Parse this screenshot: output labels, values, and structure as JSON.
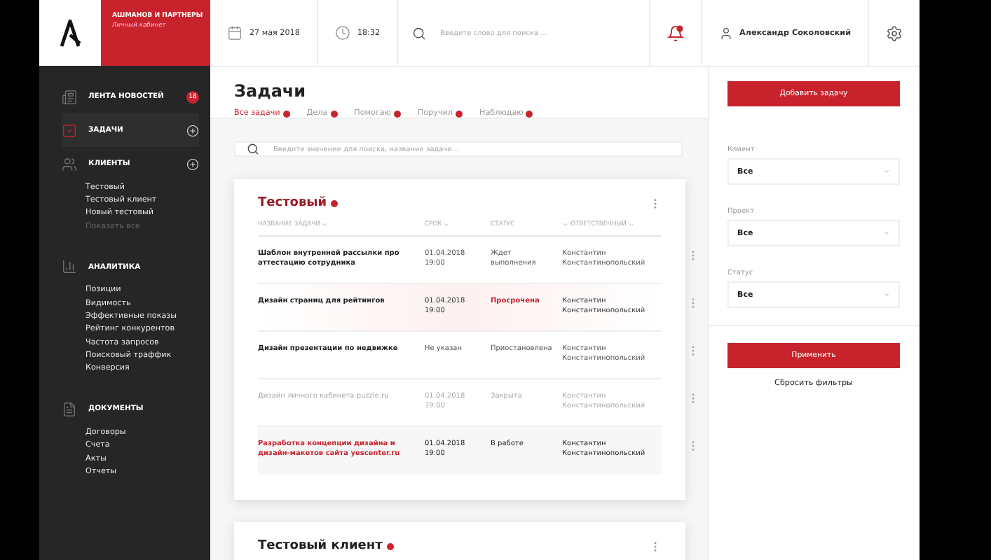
{
  "logo": {
    "title": "АШМАНОВ И ПАРТНЕРЫ",
    "subtitle": "Личный кабинет"
  },
  "topbar": {
    "date": "27 мая 2018",
    "time": "18:32",
    "search": {
      "placeholder": "Введите слово для поиска ..."
    },
    "notifications": {
      "unread": true
    },
    "user": "Александр Соколовский"
  },
  "sidebar": {
    "sections": [
      {
        "kind": "news",
        "label": "ЛЕНТА НОВОСТЕЙ",
        "selected": false,
        "badge": "18"
      },
      {
        "kind": "tasks",
        "label": "ЗАДАЧИ",
        "selected": true,
        "add": true
      },
      {
        "kind": "clients",
        "label": "КЛИЕНТЫ",
        "selected": false,
        "add": true,
        "children": [
          {
            "label": "Тестовый",
            "muted": false
          },
          {
            "label": "Тестовый клиент",
            "muted": false
          },
          {
            "label": "Новый тестовый",
            "muted": false
          },
          {
            "label": "Показать все",
            "muted": true
          }
        ]
      },
      {
        "kind": "analytics",
        "label": "АНАЛИТИКА",
        "selected": false,
        "children": [
          {
            "label": "Позиции",
            "muted": false
          },
          {
            "label": "Видимость",
            "muted": false
          },
          {
            "label": "Эффективные показы",
            "muted": false
          },
          {
            "label": "Рейтинг конкурентов",
            "muted": false
          },
          {
            "label": "Частота запросов",
            "muted": false
          },
          {
            "label": "Поисковый траффик",
            "muted": false
          },
          {
            "label": "Конверсия",
            "muted": false
          }
        ]
      },
      {
        "kind": "documents",
        "label": "ДОКУМЕНТЫ",
        "selected": false,
        "children": [
          {
            "label": "Договоры",
            "muted": false
          },
          {
            "label": "Счета",
            "muted": false
          },
          {
            "label": "Акты",
            "muted": false
          },
          {
            "label": "Отчеты",
            "muted": false
          }
        ]
      }
    ]
  },
  "page": {
    "title": "Задачи",
    "add_button": "Добавить задачу",
    "tabs": [
      {
        "label": "Все задачи",
        "selected": true
      },
      {
        "label": "Дела",
        "selected": false
      },
      {
        "label": "Помогаю",
        "selected": false
      },
      {
        "label": "Поручил",
        "selected": false
      },
      {
        "label": "Наблюдаю",
        "selected": false
      }
    ],
    "task_search": {
      "placeholder": "Введите значение для поиска, название задачи..."
    },
    "groups": [
      {
        "title": "Тестовый",
        "columns": [
          {
            "label": "НАЗВАНИЕ ЗАДАЧИ",
            "sort_before": false,
            "sort_after": true
          },
          {
            "label": "СРОК",
            "sort_before": false,
            "sort_after": true
          },
          {
            "label": "СТАТУС",
            "sort_before": false,
            "sort_after": false
          },
          {
            "label": "ОТВЕТСТВЕННЫЙ",
            "sort_before": true,
            "sort_after": true
          }
        ],
        "rows": [
          {
            "kind": "normal",
            "name": "Шаблон внутренней рассылки про аттестацию сотрудника",
            "due": "01.04.2018 19:00",
            "status": "Ждет выполнения",
            "assignee": "Константин Константинопольский"
          },
          {
            "kind": "overdue",
            "name": "Дизайн страниц для рейтингов",
            "due": "01.04.2018 19:00",
            "status": "Просрочена",
            "assignee": "Константин Константинопольский"
          },
          {
            "kind": "normal",
            "name": "Дизайн презентации по недвижке",
            "due": "Не указан",
            "status": "Приостановлена",
            "assignee": "Константин Константинопольский"
          },
          {
            "kind": "closed",
            "name": "Дизайн личного кабинета puzzle.ru",
            "due": "01.04.2018 19:00",
            "status": "Закрыта",
            "assignee": "Константин Константинопольский"
          },
          {
            "kind": "active",
            "name": "Разработка концепции дизайна и дизайн-макетов сайта yescenter.ru",
            "due": "01.04.2018 19:00",
            "status": "В работе",
            "assignee": "Константин Константинопольский"
          }
        ]
      },
      {
        "title": "Тестовый клиент"
      }
    ]
  },
  "filters": {
    "fields": [
      {
        "label": "Клиент",
        "value": "Все"
      },
      {
        "label": "Проект",
        "value": "Все"
      },
      {
        "label": "Статус",
        "value": "Все"
      }
    ],
    "apply": "Применить",
    "reset": "Сбросить фильтры"
  }
}
